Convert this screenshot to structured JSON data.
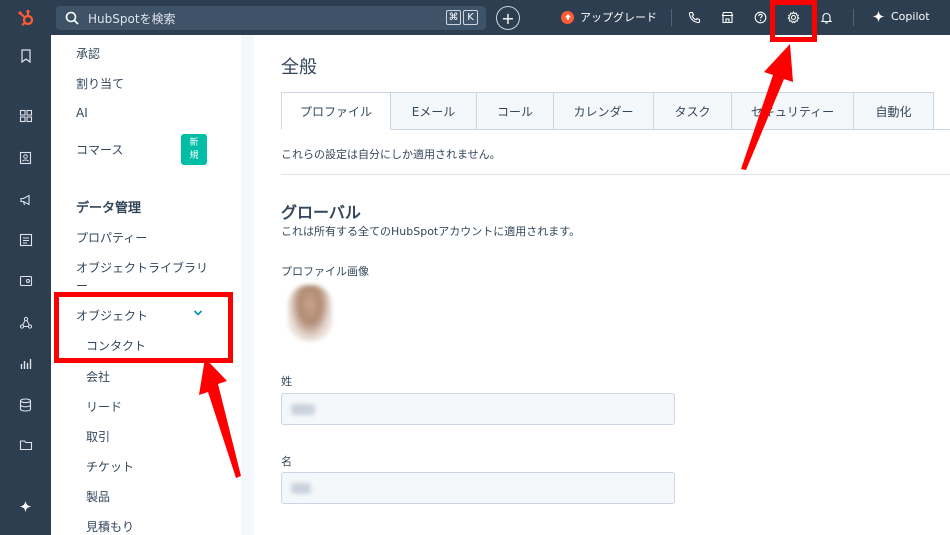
{
  "topbar": {
    "search_placeholder": "HubSpotを検索",
    "kbd_cmd": "⌘",
    "kbd_k": "K",
    "plus": "+",
    "upgrade_label": "アップグレード",
    "copilot_label": "Copilot"
  },
  "sidebar": {
    "items_top": [
      {
        "label": "承認"
      },
      {
        "label": "割り当て"
      },
      {
        "label": "AI"
      },
      {
        "label": "コマース"
      }
    ],
    "badge": "新\n規",
    "heading": "データ管理",
    "properties": "プロパティー",
    "object_library_1": "オブジェクトライブラリ",
    "object_library_2": "ー",
    "objects": "オブジェクト",
    "sub_items": [
      {
        "label": "コンタクト"
      },
      {
        "label": "会社"
      },
      {
        "label": "リード"
      },
      {
        "label": "取引"
      },
      {
        "label": "チケット"
      },
      {
        "label": "製品"
      },
      {
        "label": "見積もり"
      }
    ]
  },
  "main": {
    "title": "全般",
    "tabs": [
      {
        "label": "プロファイル"
      },
      {
        "label": "Eメール"
      },
      {
        "label": "コール"
      },
      {
        "label": "カレンダー"
      },
      {
        "label": "タスク"
      },
      {
        "label": "セキュリティー"
      },
      {
        "label": "自動化"
      }
    ],
    "note": "これらの設定は自分にしか適用されません。",
    "section_title": "グローバル",
    "section_sub": "これは所有する全てのHubSpotアカウントに適用されます。",
    "profile_image_label": "プロファイル画像",
    "last_name_label": "姓",
    "first_name_label": "名"
  },
  "colors": {
    "nav_bg": "#2d3e50",
    "accent_orange": "#ff5c35",
    "badge_teal": "#00bda5",
    "annotation_red": "#ff0000"
  }
}
